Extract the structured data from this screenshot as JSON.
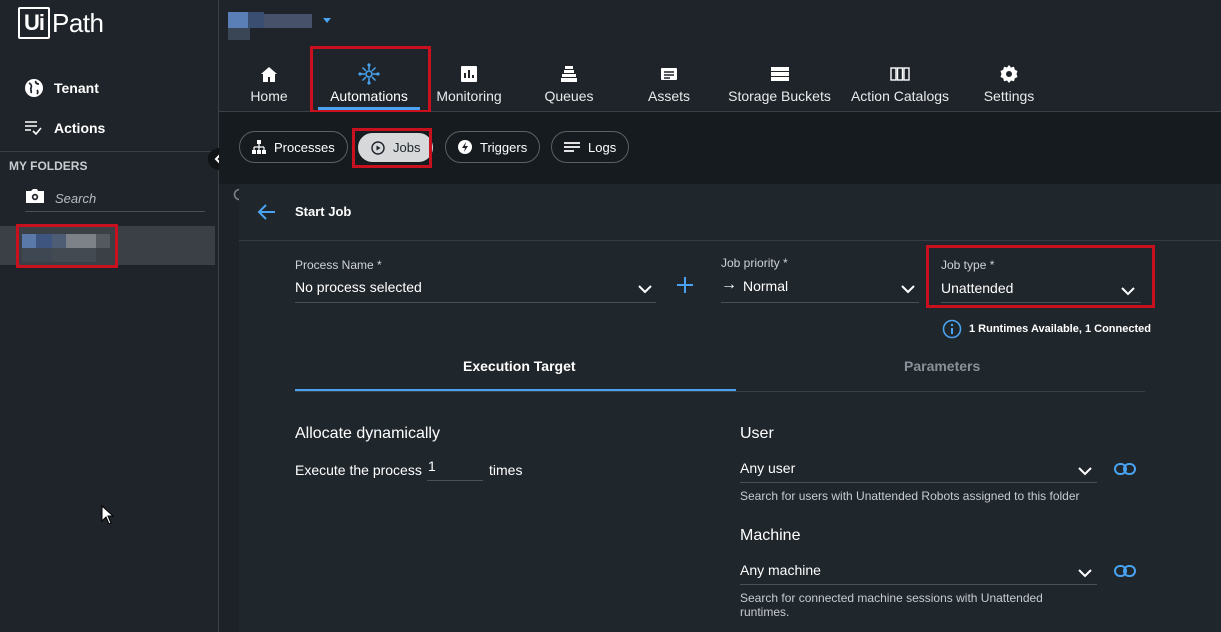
{
  "logo": {
    "ui": "Ui",
    "path": "Path"
  },
  "sidebar": {
    "items": [
      {
        "label": "Tenant",
        "icon": "globe-icon"
      },
      {
        "label": "Actions",
        "icon": "actions-icon"
      }
    ],
    "folders_title": "MY FOLDERS",
    "search_placeholder": "Search"
  },
  "nav": {
    "tabs": [
      {
        "label": "Home",
        "icon": "home-icon"
      },
      {
        "label": "Automations",
        "icon": "automations-icon",
        "active": true
      },
      {
        "label": "Monitoring",
        "icon": "monitoring-icon"
      },
      {
        "label": "Queues",
        "icon": "queues-icon"
      },
      {
        "label": "Assets",
        "icon": "assets-icon"
      },
      {
        "label": "Storage Buckets",
        "icon": "storage-icon"
      },
      {
        "label": "Action Catalogs",
        "icon": "catalogs-icon"
      },
      {
        "label": "Settings",
        "icon": "gear-icon"
      }
    ]
  },
  "subtabs": [
    {
      "label": "Processes",
      "icon": "processes-icon"
    },
    {
      "label": "Jobs",
      "icon": "play-icon",
      "active": true
    },
    {
      "label": "Triggers",
      "icon": "bolt-icon"
    },
    {
      "label": "Logs",
      "icon": "lines-icon"
    }
  ],
  "form": {
    "title": "Start Job",
    "process_name": {
      "label": "Process Name *",
      "value": "No process selected"
    },
    "job_priority": {
      "label": "Job priority *",
      "value": "Normal",
      "arrow": "→"
    },
    "job_type": {
      "label": "Job type *",
      "value": "Unattended"
    },
    "runtimes": "1 Runtimes Available, 1 Connected",
    "tabs": [
      {
        "label": "Execution Target",
        "active": true
      },
      {
        "label": "Parameters"
      }
    ],
    "allocate": {
      "title": "Allocate dynamically",
      "prefix": "Execute the process",
      "count": "1",
      "suffix": "times"
    },
    "user": {
      "title": "User",
      "value": "Any user",
      "hint": "Search for users with Unattended Robots assigned to this folder"
    },
    "machine": {
      "title": "Machine",
      "value": "Any machine",
      "hint": "Search for connected machine sessions with Unattended runtimes."
    }
  },
  "colors": {
    "accent": "#4aa3f0",
    "highlight": "#c8101e",
    "background": "#1c2228",
    "panel": "#1f262c"
  }
}
